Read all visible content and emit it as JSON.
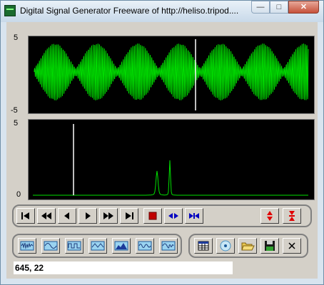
{
  "window": {
    "title": "Digital Signal Generator  Freeware of http://heliso.tripod....",
    "minimize_glyph": "—",
    "maximize_glyph": "□",
    "close_glyph": "✕"
  },
  "scope_top": {
    "y_max_label": "5",
    "y_min_label": "-5",
    "trace_color": "#00e000",
    "cursor_color": "#ffffff"
  },
  "scope_bottom": {
    "y_max_label": "5",
    "y_min_label": "0",
    "trace_color": "#00e000",
    "cursor_color": "#ffffff"
  },
  "transport": {
    "buttons": [
      "skip-to-start-icon",
      "fast-rewind-icon",
      "step-back-icon",
      "play-icon",
      "fast-forward-icon",
      "skip-to-end-icon",
      "stop-icon",
      "expand-horizontal-icon",
      "compress-horizontal-icon"
    ],
    "stop_color": "#c00000",
    "accent_color": "#0000c0",
    "vertical_zoom_color": "#e00000"
  },
  "waveforms": [
    "noise-wave-icon",
    "sine-wave-icon",
    "square-wave-icon",
    "triangle-wave-icon",
    "sweep-wave-icon",
    "am-wave-icon",
    "fm-wave-icon"
  ],
  "file_tools": [
    "data-table-icon",
    "cd-icon",
    "open-folder-icon",
    "save-disk-icon",
    "close-icon"
  ],
  "status": {
    "coords": "645, 22"
  }
}
